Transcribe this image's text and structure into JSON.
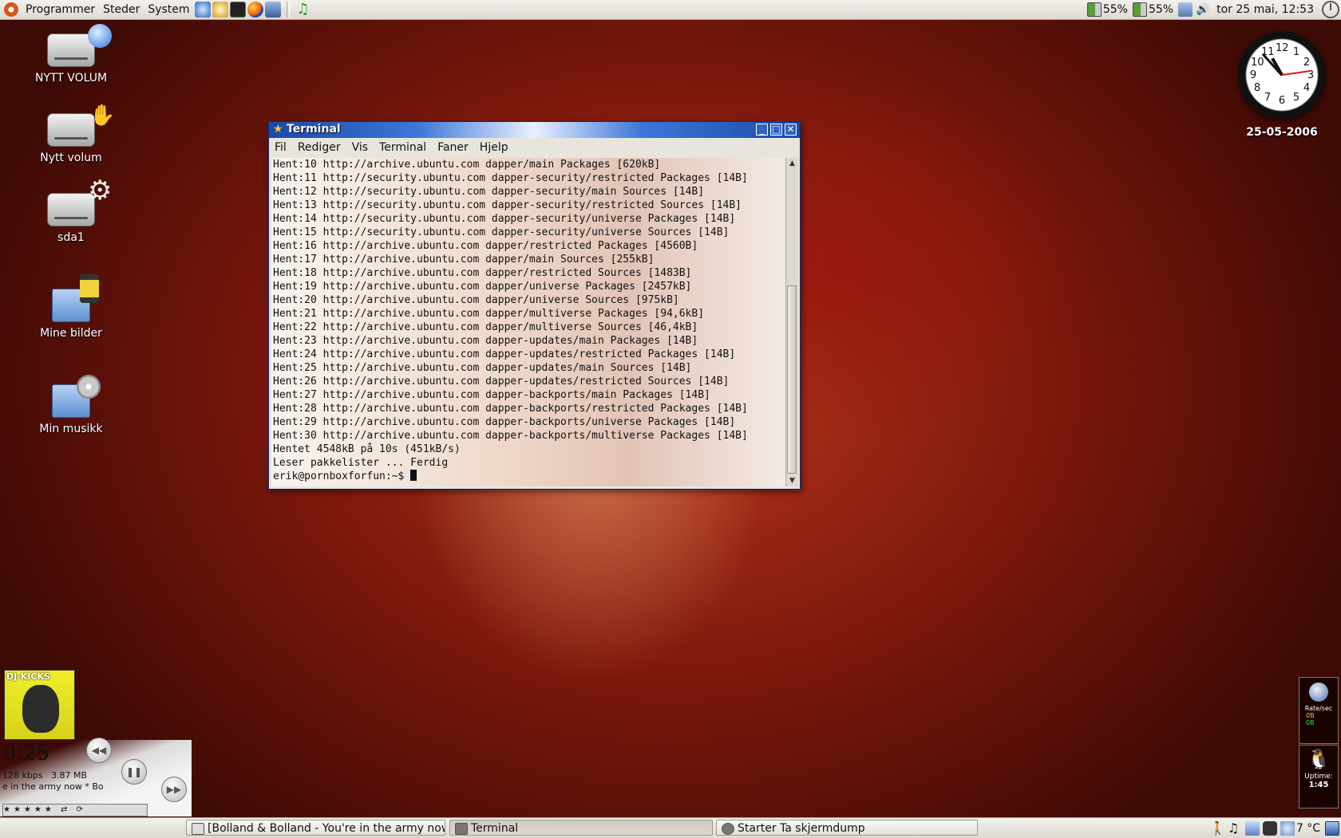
{
  "top_panel": {
    "menus": [
      "Programmer",
      "Steder",
      "System"
    ],
    "battery1": "55%",
    "battery2": "55%",
    "datetime": "tor 25 mai, 12:53",
    "icons": [
      "ubuntu-logo-icon",
      "network-icon",
      "preferences-icon",
      "terminal-icon",
      "firefox-icon",
      "editor-icon",
      "music-icon",
      "battery-icon",
      "volume-icon",
      "power-icon"
    ]
  },
  "desktop_icons": [
    {
      "label": "NYTT VOLUM"
    },
    {
      "label": "Nytt volum"
    },
    {
      "label": "sda1"
    },
    {
      "label": "Mine bilder"
    },
    {
      "label": "Min musikk"
    }
  ],
  "clock": {
    "date": "25-05-2006",
    "numbers": [
      "12",
      "1",
      "2",
      "3",
      "4",
      "5",
      "6",
      "7",
      "8",
      "9",
      "10",
      "11"
    ]
  },
  "terminal": {
    "title": "Terminal",
    "menu": [
      "Fil",
      "Rediger",
      "Vis",
      "Terminal",
      "Faner",
      "Hjelp"
    ],
    "lines": [
      "Hent:10 http://archive.ubuntu.com dapper/main Packages [620kB]",
      "Hent:11 http://security.ubuntu.com dapper-security/restricted Packages [14B]",
      "Hent:12 http://security.ubuntu.com dapper-security/main Sources [14B]",
      "Hent:13 http://security.ubuntu.com dapper-security/restricted Sources [14B]",
      "Hent:14 http://security.ubuntu.com dapper-security/universe Packages [14B]",
      "Hent:15 http://security.ubuntu.com dapper-security/universe Sources [14B]",
      "Hent:16 http://archive.ubuntu.com dapper/restricted Packages [4560B]",
      "Hent:17 http://archive.ubuntu.com dapper/main Sources [255kB]",
      "Hent:18 http://archive.ubuntu.com dapper/restricted Sources [1483B]",
      "Hent:19 http://archive.ubuntu.com dapper/universe Packages [2457kB]",
      "Hent:20 http://archive.ubuntu.com dapper/universe Sources [975kB]",
      "Hent:21 http://archive.ubuntu.com dapper/multiverse Packages [94,6kB]",
      "Hent:22 http://archive.ubuntu.com dapper/multiverse Sources [46,4kB]",
      "Hent:23 http://archive.ubuntu.com dapper-updates/main Packages [14B]",
      "Hent:24 http://archive.ubuntu.com dapper-updates/restricted Packages [14B]",
      "Hent:25 http://archive.ubuntu.com dapper-updates/main Sources [14B]",
      "Hent:26 http://archive.ubuntu.com dapper-updates/restricted Sources [14B]",
      "Hent:27 http://archive.ubuntu.com dapper-backports/main Packages [14B]",
      "Hent:28 http://archive.ubuntu.com dapper-backports/restricted Packages [14B]",
      "Hent:29 http://archive.ubuntu.com dapper-backports/universe Packages [14B]",
      "Hent:30 http://archive.ubuntu.com dapper-backports/multiverse Packages [14B]",
      "Hentet 4548kB på 10s (451kB/s)",
      "Leser pakkelister ... Ferdig"
    ],
    "prompt": "erik@pornboxforfun:~$ "
  },
  "player": {
    "album_text": "DJ-KICKS",
    "time": "0:25",
    "bitrate": "128 kbps",
    "size": "3.87 MB",
    "scroll_text": "e in the army now  *  Bo"
  },
  "monitors": {
    "net_label": "Rate/sec",
    "net_in": "0B",
    "net_out": "0B",
    "uptime_label": "Uptime:",
    "uptime_value": "1:45"
  },
  "taskbar": [
    {
      "label": "[Bolland & Bolland - You're in the army now]"
    },
    {
      "label": "Terminal"
    },
    {
      "label": "Starter Ta skjermdump"
    }
  ],
  "bottom_tray": {
    "temperature": "7 °C"
  },
  "colors": {
    "title_bar": "#1a4aa8",
    "desktop": "#a8301a",
    "panel": "#e9e6df"
  }
}
